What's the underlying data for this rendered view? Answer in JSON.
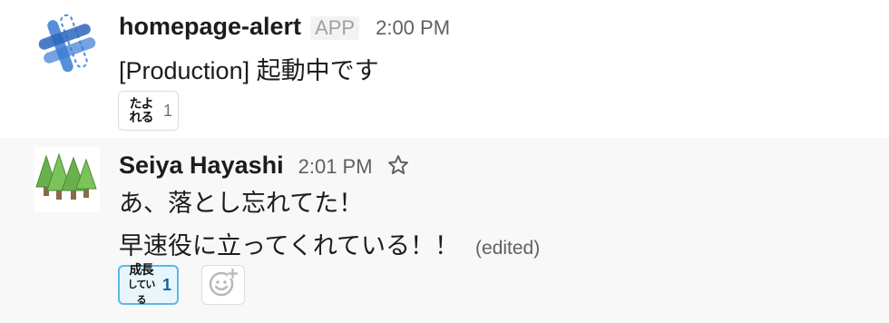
{
  "messages": [
    {
      "sender": "homepage-alert",
      "badge": "APP",
      "time": "2:00 PM",
      "lines": [
        "[Production] 起動中です"
      ],
      "avatar_icon": "app-hash-logo-icon",
      "reactions": [
        {
          "emoji_text": "たよれる",
          "count": "1",
          "active": false
        }
      ]
    },
    {
      "sender": "Seiya Hayashi",
      "time": "2:01 PM",
      "star_icon": "star-icon",
      "lines": [
        "あ、落とし忘れてた！",
        "早速役に立ってくれている！！"
      ],
      "edited": "(edited)",
      "avatar_icon": "trees-icon",
      "reactions": [
        {
          "emoji_text_top": "成長",
          "emoji_text_bottom": "している",
          "count": "1",
          "active": true
        }
      ],
      "add_reaction_icon": "add-reaction-icon"
    }
  ],
  "colors": {
    "reaction_active_border": "#5eb7e6",
    "reaction_active_bg": "#e8f5fa",
    "count_active": "#1264a3"
  }
}
